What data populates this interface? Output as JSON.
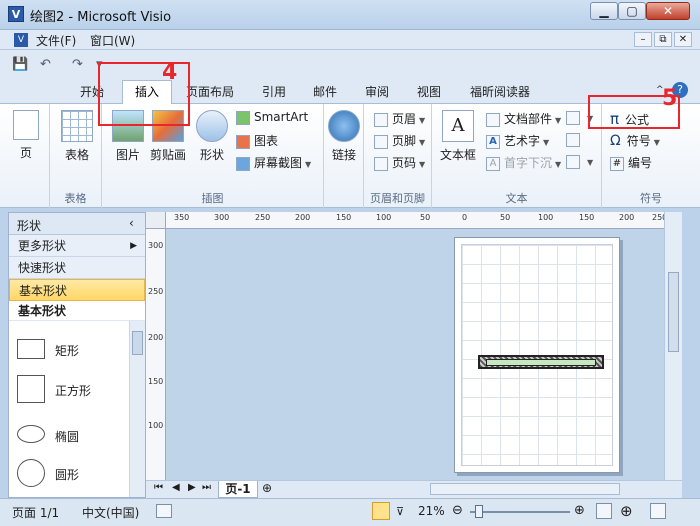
{
  "window": {
    "app_icon": "V",
    "title": "绘图2 - Microsoft Visio",
    "min": "▁",
    "max": "▢",
    "close": "✕"
  },
  "menu": {
    "items": [
      "文件(F)",
      "窗口(W)"
    ],
    "mdi": [
      "–",
      "⧉",
      "✕"
    ]
  },
  "qat": {
    "save": "💾",
    "undo": "↶",
    "redo": "↷",
    "more": "▾"
  },
  "tabs": [
    "开始",
    "插入",
    "页面布局",
    "引用",
    "邮件",
    "审阅",
    "视图",
    "福昕阅读器"
  ],
  "ribbon": {
    "page": {
      "btn": "页",
      "group": ""
    },
    "table": {
      "btn": "表格",
      "group": "表格"
    },
    "illustrations": {
      "picture": "图片",
      "clipart": "剪贴画",
      "shapes": "形状",
      "smartart": "SmartArt",
      "chart": "图表",
      "screenshot": "屏幕截图",
      "group": "插图"
    },
    "links": {
      "btn": "链接",
      "group": ""
    },
    "header_footer": {
      "header": "页眉",
      "footer": "页脚",
      "pagenum": "页码",
      "group": "页眉和页脚"
    },
    "text": {
      "textbox": "文本框",
      "docparts": "文档部件",
      "wordart": "艺术字",
      "dropcap": "首字下沉",
      "group": "文本"
    },
    "symbols": {
      "equation": "公式",
      "symbol": "符号",
      "number": "编号",
      "group": "符号",
      "pi": "π",
      "omega": "Ω"
    }
  },
  "annotations": {
    "a1": "4",
    "a2": "5"
  },
  "sidebar": {
    "header": "形状",
    "rows": [
      "更多形状",
      "快速形状",
      "基本形状"
    ],
    "stencil_title": "基本形状",
    "shapes": [
      "矩形",
      "正方形",
      "椭圆",
      "圆形"
    ]
  },
  "ruler": {
    "h": [
      "350",
      "300",
      "250",
      "200",
      "150",
      "100",
      "50",
      "0",
      "50",
      "100",
      "150",
      "200",
      "250"
    ],
    "v": [
      "300",
      "250",
      "200",
      "150",
      "100"
    ]
  },
  "page_tabs": {
    "current": "页-1"
  },
  "status": {
    "page": "页面 1/1",
    "lang": "中文(中国)",
    "zoom": "21%"
  }
}
